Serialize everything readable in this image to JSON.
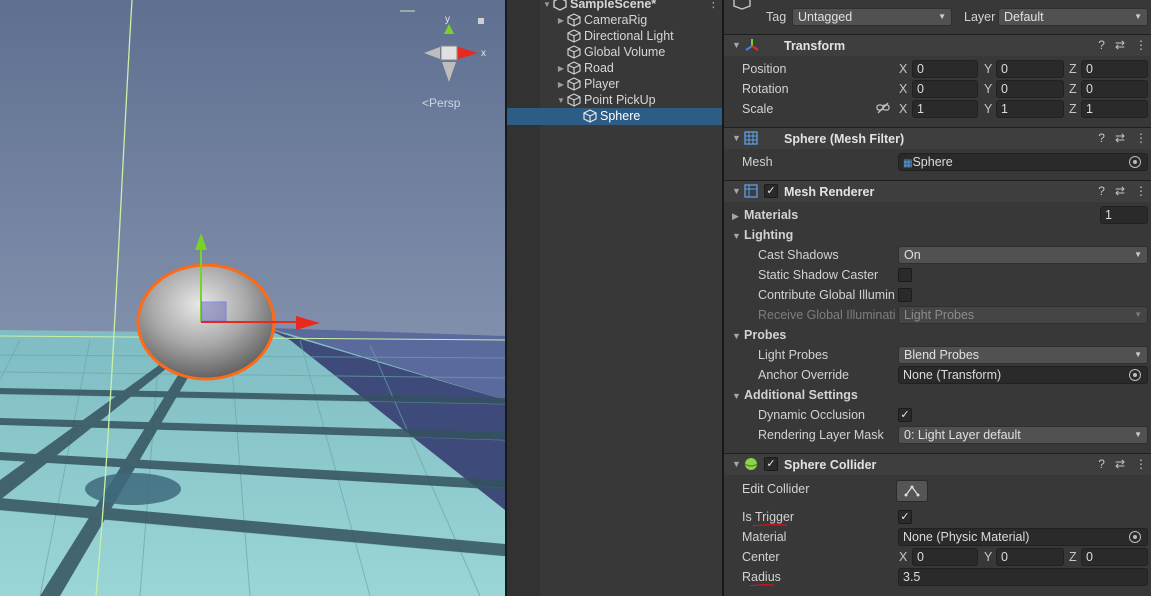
{
  "scene_view": {
    "persp_label": "Persp",
    "gizmo_axes": {
      "y": "y",
      "x": "x"
    },
    "colors": {
      "sky": "#7f91b2",
      "ground": "#8fcfd0",
      "selection_outline": "#ff6a17",
      "x_axis": "#e8291f",
      "y_axis": "#7ad128"
    }
  },
  "hierarchy": {
    "root_label": "SampleScene*",
    "items": [
      {
        "label": "CameraRig",
        "expandable": true
      },
      {
        "label": "Directional Light",
        "expandable": false
      },
      {
        "label": "Global Volume",
        "expandable": false
      },
      {
        "label": "Road",
        "expandable": true
      },
      {
        "label": "Player",
        "expandable": true
      },
      {
        "label": "Point PickUp",
        "expandable": true,
        "expanded": true
      },
      {
        "label": "Sphere",
        "expandable": false,
        "selected": true
      }
    ]
  },
  "inspector": {
    "tag_label": "Tag",
    "tag_value": "Untagged",
    "layer_label": "Layer",
    "layer_value": "Default",
    "transform": {
      "title": "Transform",
      "position": {
        "label": "Position",
        "x": "0",
        "y": "0",
        "z": "0"
      },
      "rotation": {
        "label": "Rotation",
        "x": "0",
        "y": "0",
        "z": "0"
      },
      "scale": {
        "label": "Scale",
        "x": "1",
        "y": "1",
        "z": "1"
      },
      "axis_x": "X",
      "axis_y": "Y",
      "axis_z": "Z"
    },
    "mesh_filter": {
      "title": "Sphere (Mesh Filter)",
      "mesh_label": "Mesh",
      "mesh_value": "Sphere"
    },
    "mesh_renderer": {
      "title": "Mesh Renderer",
      "materials_label": "Materials",
      "materials_count": "1",
      "lighting_label": "Lighting",
      "cast_shadows_label": "Cast Shadows",
      "cast_shadows_value": "On",
      "static_shadow_label": "Static Shadow Caster",
      "contribute_gi_label": "Contribute Global Illumin",
      "receive_gi_label": "Receive Global Illuminati",
      "receive_gi_value": "Light Probes",
      "probes_label": "Probes",
      "light_probes_label": "Light Probes",
      "light_probes_value": "Blend Probes",
      "anchor_override_label": "Anchor Override",
      "anchor_override_value": "None (Transform)",
      "additional_label": "Additional Settings",
      "dynamic_occlusion_label": "Dynamic Occlusion",
      "rendering_layer_label": "Rendering Layer Mask",
      "rendering_layer_value": "0: Light Layer default"
    },
    "sphere_collider": {
      "title": "Sphere Collider",
      "edit_collider_label": "Edit Collider",
      "is_trigger_label": "Is Trigger",
      "material_label": "Material",
      "material_value": "None (Physic Material)",
      "center_label": "Center",
      "center": {
        "x": "0",
        "y": "0",
        "z": "0"
      },
      "radius_label": "Radius",
      "radius_value": "3.5"
    },
    "check_mark": "✓",
    "help_icon": "?",
    "preset_icon": "⇄",
    "kebab_icon": "⋮"
  }
}
